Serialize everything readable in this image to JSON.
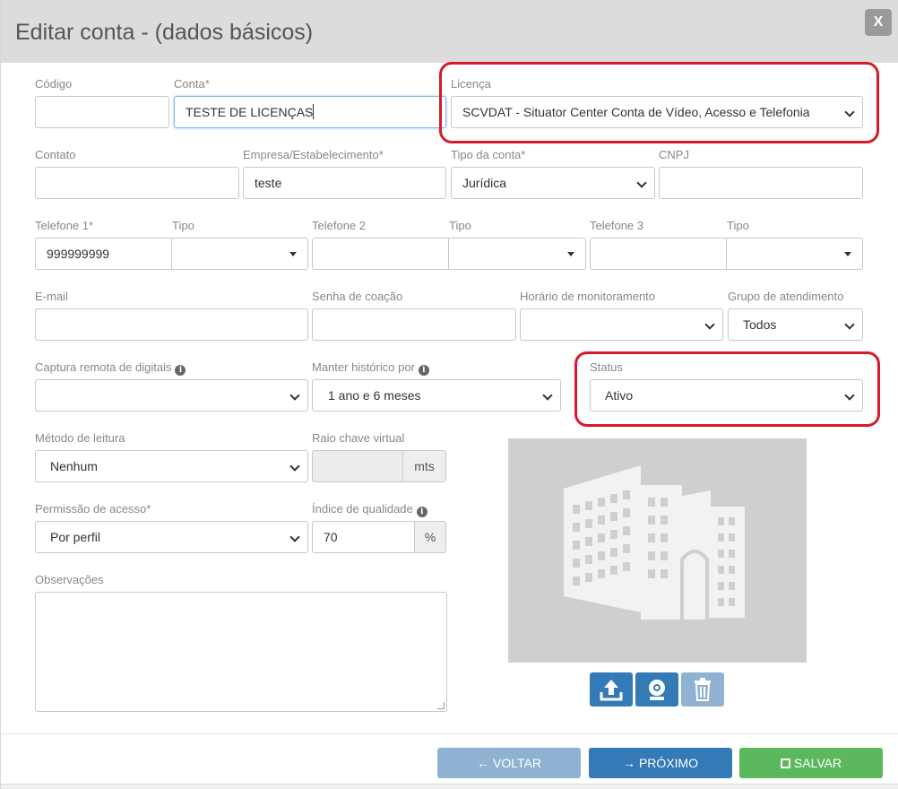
{
  "header": {
    "title": "Editar conta - (dados básicos)",
    "close_label": "X"
  },
  "fields": {
    "codigo": {
      "label": "Código",
      "value": ""
    },
    "conta": {
      "label": "Conta*",
      "value": "TESTE DE LICENÇAS"
    },
    "licenca": {
      "label": "Licença",
      "value": "SCVDAT - Situator Center Conta de Vídeo, Acesso e Telefonia"
    },
    "contato": {
      "label": "Contato",
      "value": ""
    },
    "empresa": {
      "label": "Empresa/Estabelecimento*",
      "value": "teste"
    },
    "tipo_conta": {
      "label": "Tipo da conta*",
      "value": "Jurídica"
    },
    "cnpj": {
      "label": "CNPJ",
      "value": ""
    },
    "telefone1": {
      "label": "Telefone 1*",
      "value": "999999999"
    },
    "tipo1": {
      "label": "Tipo",
      "value": ""
    },
    "telefone2": {
      "label": "Telefone 2",
      "value": ""
    },
    "tipo2": {
      "label": "Tipo",
      "value": ""
    },
    "telefone3": {
      "label": "Telefone 3",
      "value": ""
    },
    "tipo3": {
      "label": "Tipo",
      "value": ""
    },
    "email": {
      "label": "E-mail",
      "value": ""
    },
    "senha_coacao": {
      "label": "Senha de coação",
      "value": ""
    },
    "horario": {
      "label": "Horário de monitoramento",
      "value": ""
    },
    "grupo": {
      "label": "Grupo de atendimento",
      "value": "Todos"
    },
    "captura": {
      "label": "Captura remota de digitais",
      "value": ""
    },
    "historico": {
      "label": "Manter histórico por",
      "value": "1 ano e 6 meses"
    },
    "status": {
      "label": "Status",
      "value": "Ativo"
    },
    "metodo": {
      "label": "Método de leitura",
      "value": "Nenhum"
    },
    "raio": {
      "label": "Raio chave virtual",
      "value": "",
      "unit": "mts"
    },
    "permissao": {
      "label": "Permissão de acesso*",
      "value": "Por perfil"
    },
    "indice": {
      "label": "Índice de qualidade",
      "value": "70",
      "unit": "%"
    },
    "observacoes": {
      "label": "Observações",
      "value": ""
    }
  },
  "footer": {
    "back_label": "VOLTAR",
    "next_label": "PRÓXIMO",
    "save_label": "SALVAR"
  },
  "icons": {
    "info": "info-circle-icon",
    "photo": "building-icon",
    "upload": "upload-icon",
    "webcam": "webcam-icon",
    "delete": "trash-icon",
    "back": "arrow-left-icon",
    "next": "arrow-right-icon",
    "save": "floppy-disk-icon"
  },
  "colors": {
    "primary": "#337ab7",
    "success": "#5cb85c",
    "disabled_primary": "#8fb2d2",
    "highlight": "#d61a2a",
    "header_bg": "#dcdcdc"
  }
}
